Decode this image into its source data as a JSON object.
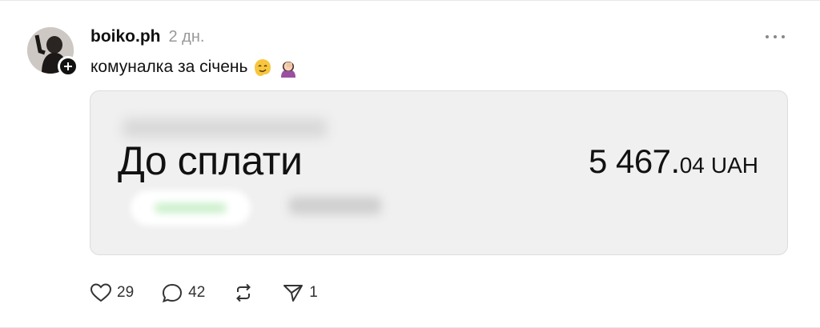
{
  "post": {
    "username": "boiko.ph",
    "timestamp": "2 дн.",
    "caption": "комуналка за січень",
    "caption_emojis": [
      "melting-face-emoji",
      "woman-facepalming-emoji"
    ],
    "more_icon": "more-dots-icon"
  },
  "media": {
    "label": "До сплати",
    "amount_main": "5 467.",
    "amount_decimals": "04",
    "currency": "UAH"
  },
  "actions": {
    "likes": "29",
    "comments": "42",
    "shares": "1"
  },
  "colors": {
    "text": "#111111",
    "muted": "#999999",
    "card_bg": "#f0f0f0"
  }
}
